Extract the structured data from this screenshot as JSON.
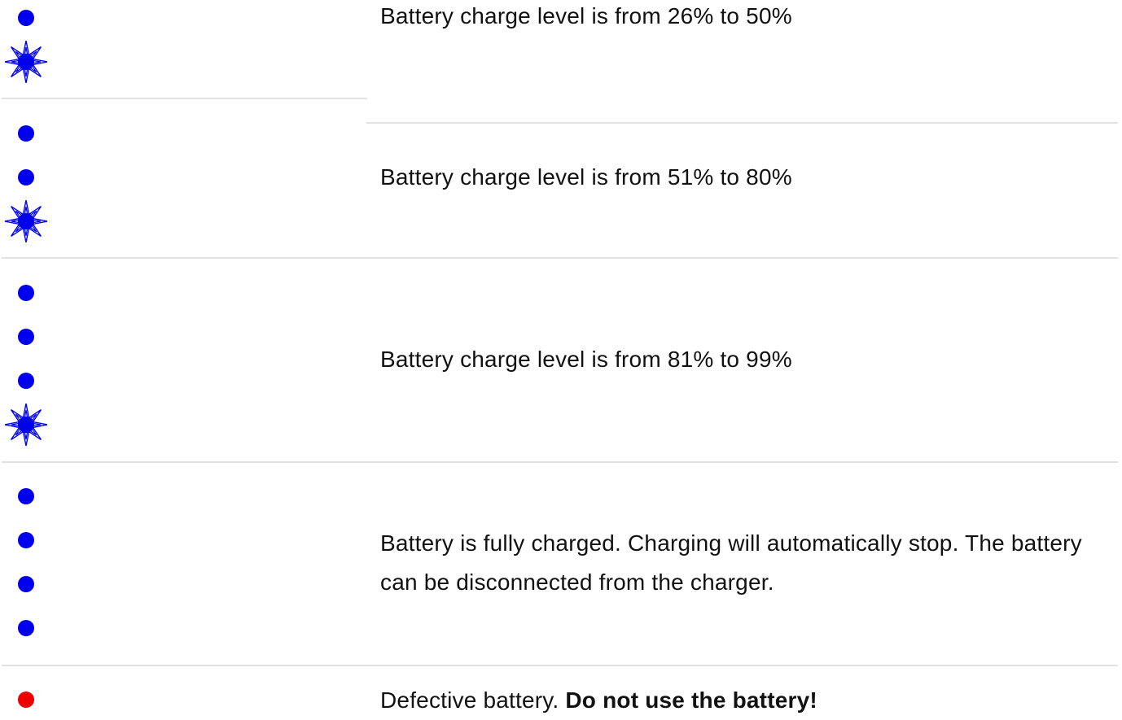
{
  "rows": [
    {
      "indicator": {
        "solid": 1,
        "flashing": 1,
        "color": "#0000ee"
      },
      "text": "Battery charge level is from 26% to 50%"
    },
    {
      "indicator": {
        "solid": 2,
        "flashing": 1,
        "color": "#0000ee"
      },
      "text": "Battery charge level is from 51% to 80%"
    },
    {
      "indicator": {
        "solid": 3,
        "flashing": 1,
        "color": "#0000ee"
      },
      "text": "Battery charge level is from 81% to 99%"
    },
    {
      "indicator": {
        "solid": 4,
        "flashing": 0,
        "color": "#0000ee"
      },
      "text_line1": "Battery is fully charged. Charging will automatically stop. The battery",
      "text_line2": "can be disconnected from the charger."
    },
    {
      "indicator": {
        "solid": 1,
        "flashing": 0,
        "color": "#ee0000"
      },
      "text": "Defective battery.",
      "warning": "Do not use the battery!"
    }
  ],
  "icons": {
    "solid": "led-dot-icon",
    "flashing": "flashing-led-icon",
    "error": "red-led-dot-icon"
  }
}
